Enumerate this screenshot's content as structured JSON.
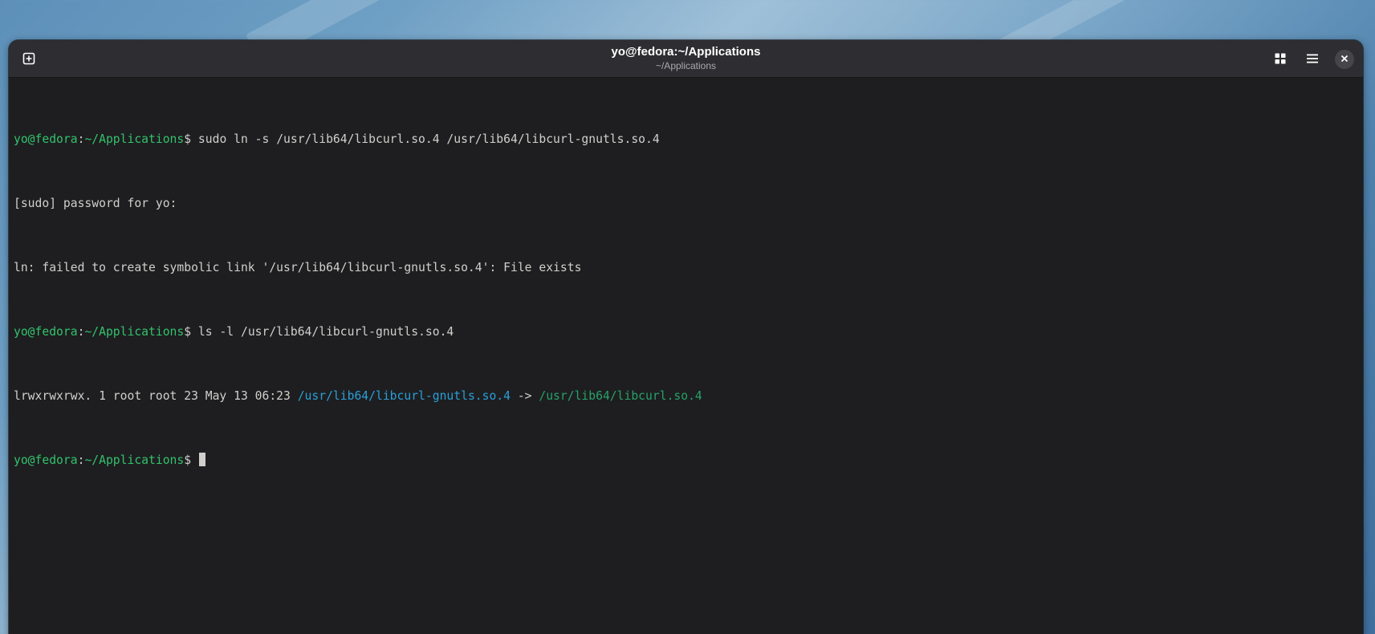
{
  "window": {
    "title": "yo@fedora:~/Applications",
    "subtitle": "~/Applications"
  },
  "icons": {
    "new_tab": "new-tab-icon",
    "tabs_overview": "grid-icon",
    "menu": "hamburger-menu-icon",
    "close": "close-icon"
  },
  "colors": {
    "terminal_bg": "#1e1e21",
    "prompt_green": "#33c26b",
    "symlink_cyan": "#2a9fd6",
    "target_green": "#26a269",
    "text": "#d0cfcc"
  },
  "terminal": {
    "prompt_user": "yo@fedora",
    "prompt_colon": ":",
    "prompt_path": "~/Applications",
    "prompt_dollar": "$ ",
    "lines": [
      {
        "command": "sudo ln -s /usr/lib64/libcurl.so.4 /usr/lib64/libcurl-gnutls.so.4"
      },
      {
        "text": "[sudo] password for yo:"
      },
      {
        "text": "ln: failed to create symbolic link '/usr/lib64/libcurl-gnutls.so.4': File exists"
      },
      {
        "command": "ls -l /usr/lib64/libcurl-gnutls.so.4"
      },
      {
        "ls_meta": "lrwxrwxrwx. 1 root root 23 May 13 06:23 ",
        "ls_link": "/usr/lib64/libcurl-gnutls.so.4",
        "ls_arrow": " -> ",
        "ls_target": "/usr/lib64/libcurl.so.4"
      },
      {
        "command": ""
      }
    ]
  }
}
